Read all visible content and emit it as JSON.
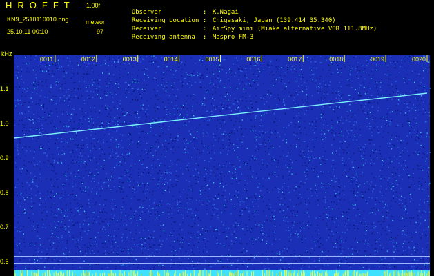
{
  "header": {
    "app_title": "HROFFT",
    "version": "1.00f",
    "filename": "KN9_2510110010.png",
    "datetime": "25.10.11 00:10",
    "meteor_label": "meteor",
    "meteor_count": "97"
  },
  "metadata": [
    {
      "key": "Observer",
      "sep": ":",
      "value": "K.Nagai"
    },
    {
      "key": "Receiving Location",
      "sep": ":",
      "value": "Chigasaki, Japan (139.414 35.340)"
    },
    {
      "key": "Receiver",
      "sep": ":",
      "value": "AirSpy mini (Miake alternative VOR 111.8MHz)"
    },
    {
      "key": "Receiving antenna",
      "sep": ":",
      "value": "Maspro FM-3"
    }
  ],
  "colors": {
    "text": "#ffff00",
    "background": "#000000",
    "plot_background": "#1a2fb5",
    "trace": "#7ff0ff",
    "bottom_band": "#40e0ff"
  },
  "chart_data": {
    "type": "heatmap",
    "ylabel": "kHz",
    "yticks": [
      "1.1",
      "1.0",
      "0.9",
      "0.8",
      "0.7",
      "0.6"
    ],
    "xticks": [
      "0011",
      "0012",
      "0013",
      "0014",
      "0015",
      "0016",
      "0017",
      "0018",
      "0019",
      "0020"
    ],
    "trace": {
      "x": [
        "0010",
        "0020"
      ],
      "y": [
        0.96,
        1.09
      ]
    },
    "horizontal_lines_khz": [
      0.617,
      0.597
    ]
  }
}
